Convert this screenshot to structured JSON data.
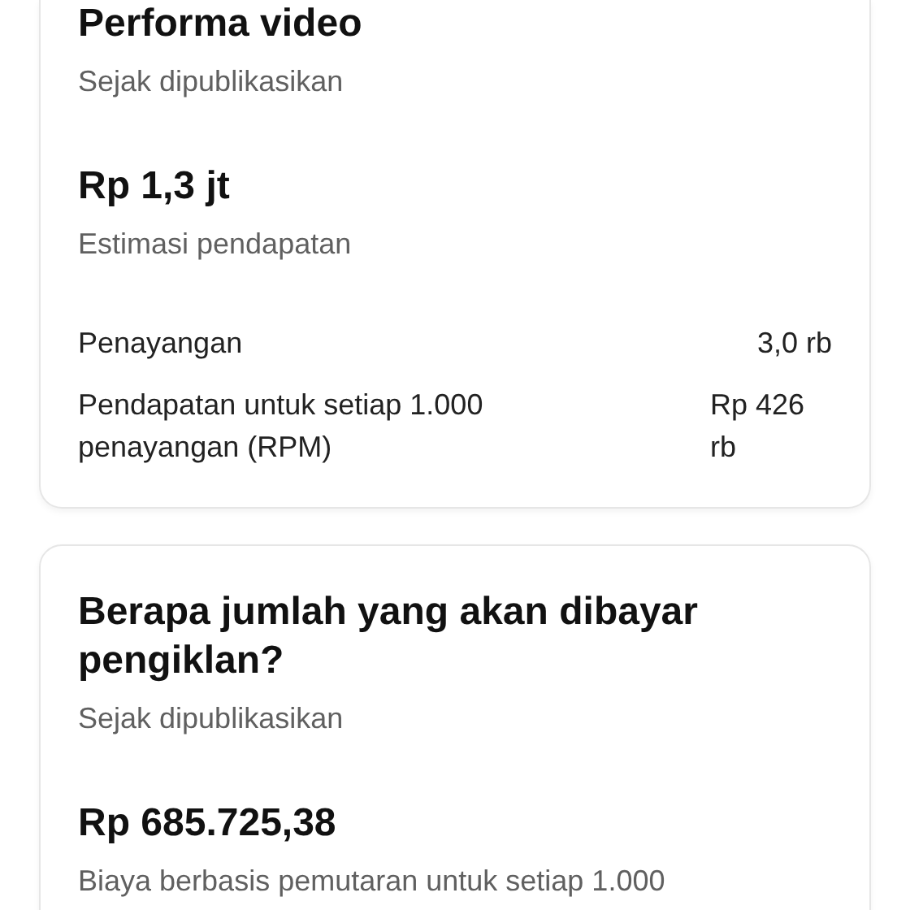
{
  "video_performance": {
    "title": "Performa video",
    "subtitle": "Sejak dipublikasikan",
    "amount": "Rp 1,3 jt",
    "amount_label": "Estimasi pendapatan",
    "metrics": [
      {
        "label": "Penayangan",
        "value": "3,0 rb"
      },
      {
        "label": "Pendapatan untuk setiap 1.000 penayangan (RPM)",
        "value": "Rp 426 rb"
      }
    ]
  },
  "advertiser_payment": {
    "title": "Berapa jumlah yang akan dibayar pengiklan?",
    "subtitle": "Sejak dipublikasikan",
    "amount": "Rp 685.725,38",
    "description": "Biaya berbasis pemutaran untuk setiap 1.000"
  }
}
